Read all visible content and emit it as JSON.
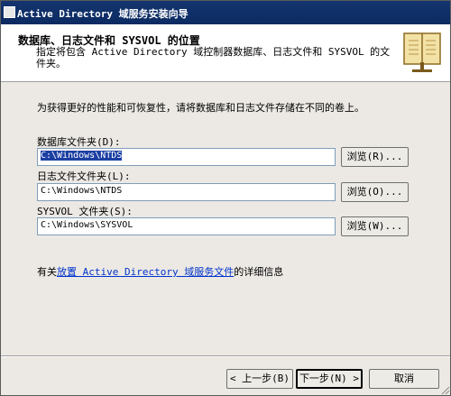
{
  "window": {
    "title": "Active Directory 域服务安装向导"
  },
  "header": {
    "title": "数据库、日志文件和 SYSVOL 的位置",
    "subtitle": "指定将包含 Active Directory 域控制器数据库、日志文件和 SYSVOL 的文件夹。",
    "icon": "book-icon"
  },
  "description": "为获得更好的性能和可恢复性，请将数据库和日志文件存储在不同的卷上。",
  "fields": [
    {
      "label": "数据库文件夹(D):",
      "value": "C:\\Windows\\NTDS",
      "browse": "浏览(R)..."
    },
    {
      "label": "日志文件文件夹(L):",
      "value": "C:\\Windows\\NTDS",
      "browse": "浏览(O)..."
    },
    {
      "label": "SYSVOL 文件夹(S):",
      "value": "C:\\Windows\\SYSVOL",
      "browse": "浏览(W)..."
    }
  ],
  "info": {
    "prefix": "有关",
    "link": "放置 Active Directory 域服务文件",
    "suffix": "的详细信息"
  },
  "buttons": {
    "back": "< 上一步(B)",
    "next": "下一步(N) >",
    "cancel": "取消"
  }
}
